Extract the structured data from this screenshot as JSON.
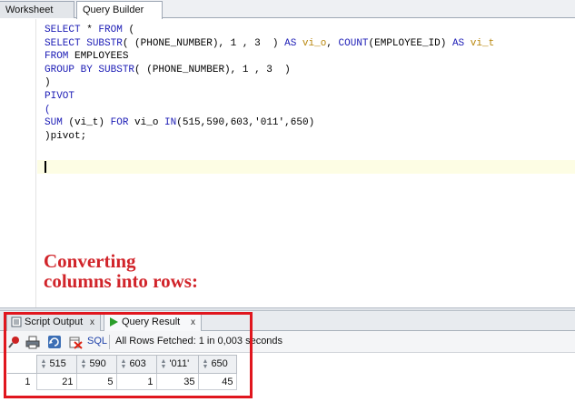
{
  "tabs": [
    {
      "label": "Worksheet",
      "active": false
    },
    {
      "label": "Query Builder",
      "active": true
    }
  ],
  "editor": {
    "lines": [
      [
        {
          "t": "SELECT ",
          "c": "kw"
        },
        {
          "t": "* ",
          "c": "id"
        },
        {
          "t": "FROM ",
          "c": "kw"
        },
        {
          "t": "(",
          "c": "id"
        }
      ],
      [
        {
          "t": "SELECT ",
          "c": "kw"
        },
        {
          "t": "SUBSTR",
          "c": "kw"
        },
        {
          "t": "( (PHONE_NUMBER), ",
          "c": "id"
        },
        {
          "t": "1",
          "c": "num"
        },
        {
          "t": " , ",
          "c": "id"
        },
        {
          "t": "3",
          "c": "num"
        },
        {
          "t": "  ) ",
          "c": "id"
        },
        {
          "t": "AS ",
          "c": "kw"
        },
        {
          "t": "vi_o",
          "c": "alias"
        },
        {
          "t": ", ",
          "c": "id"
        },
        {
          "t": "COUNT",
          "c": "kw"
        },
        {
          "t": "(EMPLOYEE_ID) ",
          "c": "id"
        },
        {
          "t": "AS ",
          "c": "kw"
        },
        {
          "t": "vi_t",
          "c": "alias"
        }
      ],
      [
        {
          "t": "FROM ",
          "c": "kw"
        },
        {
          "t": "EMPLOYEES",
          "c": "id"
        }
      ],
      [
        {
          "t": "GROUP BY ",
          "c": "kw"
        },
        {
          "t": "SUBSTR",
          "c": "kw"
        },
        {
          "t": "( (PHONE_NUMBER), ",
          "c": "id"
        },
        {
          "t": "1",
          "c": "num"
        },
        {
          "t": " , ",
          "c": "id"
        },
        {
          "t": "3",
          "c": "num"
        },
        {
          "t": "  )",
          "c": "id"
        }
      ],
      [
        {
          "t": ")",
          "c": "id"
        }
      ],
      [
        {
          "t": "PIVOT",
          "c": "kw"
        }
      ],
      [
        {
          "t": "(",
          "c": "kw"
        }
      ],
      [
        {
          "t": "SUM ",
          "c": "kw"
        },
        {
          "t": "(vi_t) ",
          "c": "id"
        },
        {
          "t": "FOR ",
          "c": "kw"
        },
        {
          "t": "vi_o ",
          "c": "id"
        },
        {
          "t": "IN",
          "c": "kw"
        },
        {
          "t": "(",
          "c": "id"
        },
        {
          "t": "515",
          "c": "num"
        },
        {
          "t": ",",
          "c": "id"
        },
        {
          "t": "590",
          "c": "num"
        },
        {
          "t": ",",
          "c": "id"
        },
        {
          "t": "603",
          "c": "num"
        },
        {
          "t": ",",
          "c": "id"
        },
        {
          "t": "'011'",
          "c": "str"
        },
        {
          "t": ",",
          "c": "id"
        },
        {
          "t": "650",
          "c": "num"
        },
        {
          "t": ")",
          "c": "id"
        }
      ],
      [
        {
          "t": ")pivot;",
          "c": "id"
        }
      ]
    ]
  },
  "annotation": {
    "line1": "Converting",
    "line2": "columns into rows:"
  },
  "panel": {
    "tabs": [
      {
        "label": "Script Output",
        "close": "x",
        "icon": "script-output-icon"
      },
      {
        "label": "Query Result",
        "close": "x",
        "icon": "play-icon"
      }
    ],
    "toolbar": {
      "sql_label": "SQL",
      "status": "All Rows Fetched: 1 in 0,003 seconds",
      "icons": [
        "pin-icon",
        "print-icon",
        "refresh-icon",
        "delete-icon"
      ]
    },
    "grid": {
      "columns": [
        "515",
        "590",
        "603",
        "'011'",
        "650"
      ],
      "rows": [
        {
          "num": "1",
          "cells": [
            "21",
            "5",
            "1",
            "35",
            "45"
          ]
        }
      ]
    }
  },
  "colors": {
    "keyword": "#1b1bb5",
    "alias": "#b8860b",
    "annotation": "#d1242a",
    "highlight_box": "#e0161e"
  }
}
